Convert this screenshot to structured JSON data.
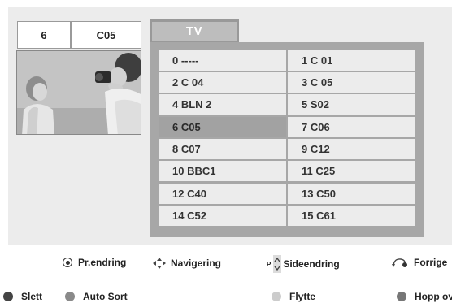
{
  "info": {
    "program_number": "6",
    "program_name": "C05"
  },
  "tab": {
    "label": "TV"
  },
  "channels": {
    "left": [
      "0 -----",
      "2 C 04",
      "4 BLN 2",
      "6 C05",
      "8 C07",
      "10 BBC1",
      "12 C40",
      "14 C52"
    ],
    "right": [
      "1 C 01",
      "3 C 05",
      "5 S02",
      "7 C06",
      "9 C12",
      "11 C25",
      "13 C50",
      "15 C61"
    ],
    "selected": "6 C05"
  },
  "legend_top": {
    "prog_change": "Pr.endring",
    "navigation": "Navigering",
    "page_change": "Sideendring",
    "page_prefix": "P",
    "back": "Forrige"
  },
  "legend_bottom": {
    "delete": "Slett",
    "auto_sort": "Auto Sort",
    "move": "Flytte",
    "skip": "Hopp ov"
  },
  "colors": {
    "red_button": "#444444",
    "green_button": "#8a8a8a",
    "yellow_button": "#cccccc",
    "blue_button": "#777777",
    "selected_row": "#a2a2a2"
  }
}
